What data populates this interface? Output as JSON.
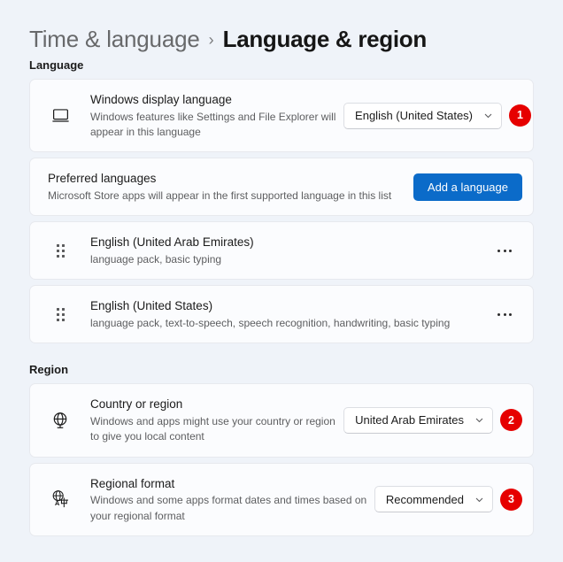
{
  "breadcrumb": {
    "parent": "Time & language",
    "separator": "›",
    "current": "Language & region"
  },
  "sections": {
    "language": {
      "heading": "Language"
    },
    "region": {
      "heading": "Region"
    }
  },
  "display_language": {
    "icon": "monitor-icon",
    "title": "Windows display language",
    "description": "Windows features like Settings and File Explorer will appear in this language",
    "dropdown_value": "English (United States)",
    "badge": "1"
  },
  "preferred_languages": {
    "title": "Preferred languages",
    "description": "Microsoft Store apps will appear in the first supported language in this list",
    "add_button_label": "Add a language"
  },
  "language_list": [
    {
      "name": "English (United Arab Emirates)",
      "features": "language pack, basic typing",
      "menu_label": "···"
    },
    {
      "name": "English (United States)",
      "features": "language pack, text-to-speech, speech recognition, handwriting, basic typing",
      "menu_label": "···"
    }
  ],
  "country_or_region": {
    "icon": "globe-icon",
    "title": "Country or region",
    "description": "Windows and apps might use your country or region to give you local content",
    "dropdown_value": "United Arab Emirates",
    "badge": "2"
  },
  "regional_format": {
    "icon": "translate-globe-icon",
    "title": "Regional format",
    "description": "Windows and some apps format dates and times based on your regional format",
    "dropdown_value": "Recommended",
    "badge": "3"
  },
  "colors": {
    "page_background": "#eff3f9",
    "card_background": "#fbfcfe",
    "accent_blue": "#0b6bc9",
    "badge_red": "#e60000",
    "title_text": "#161616",
    "muted_text": "#5d5e60"
  }
}
